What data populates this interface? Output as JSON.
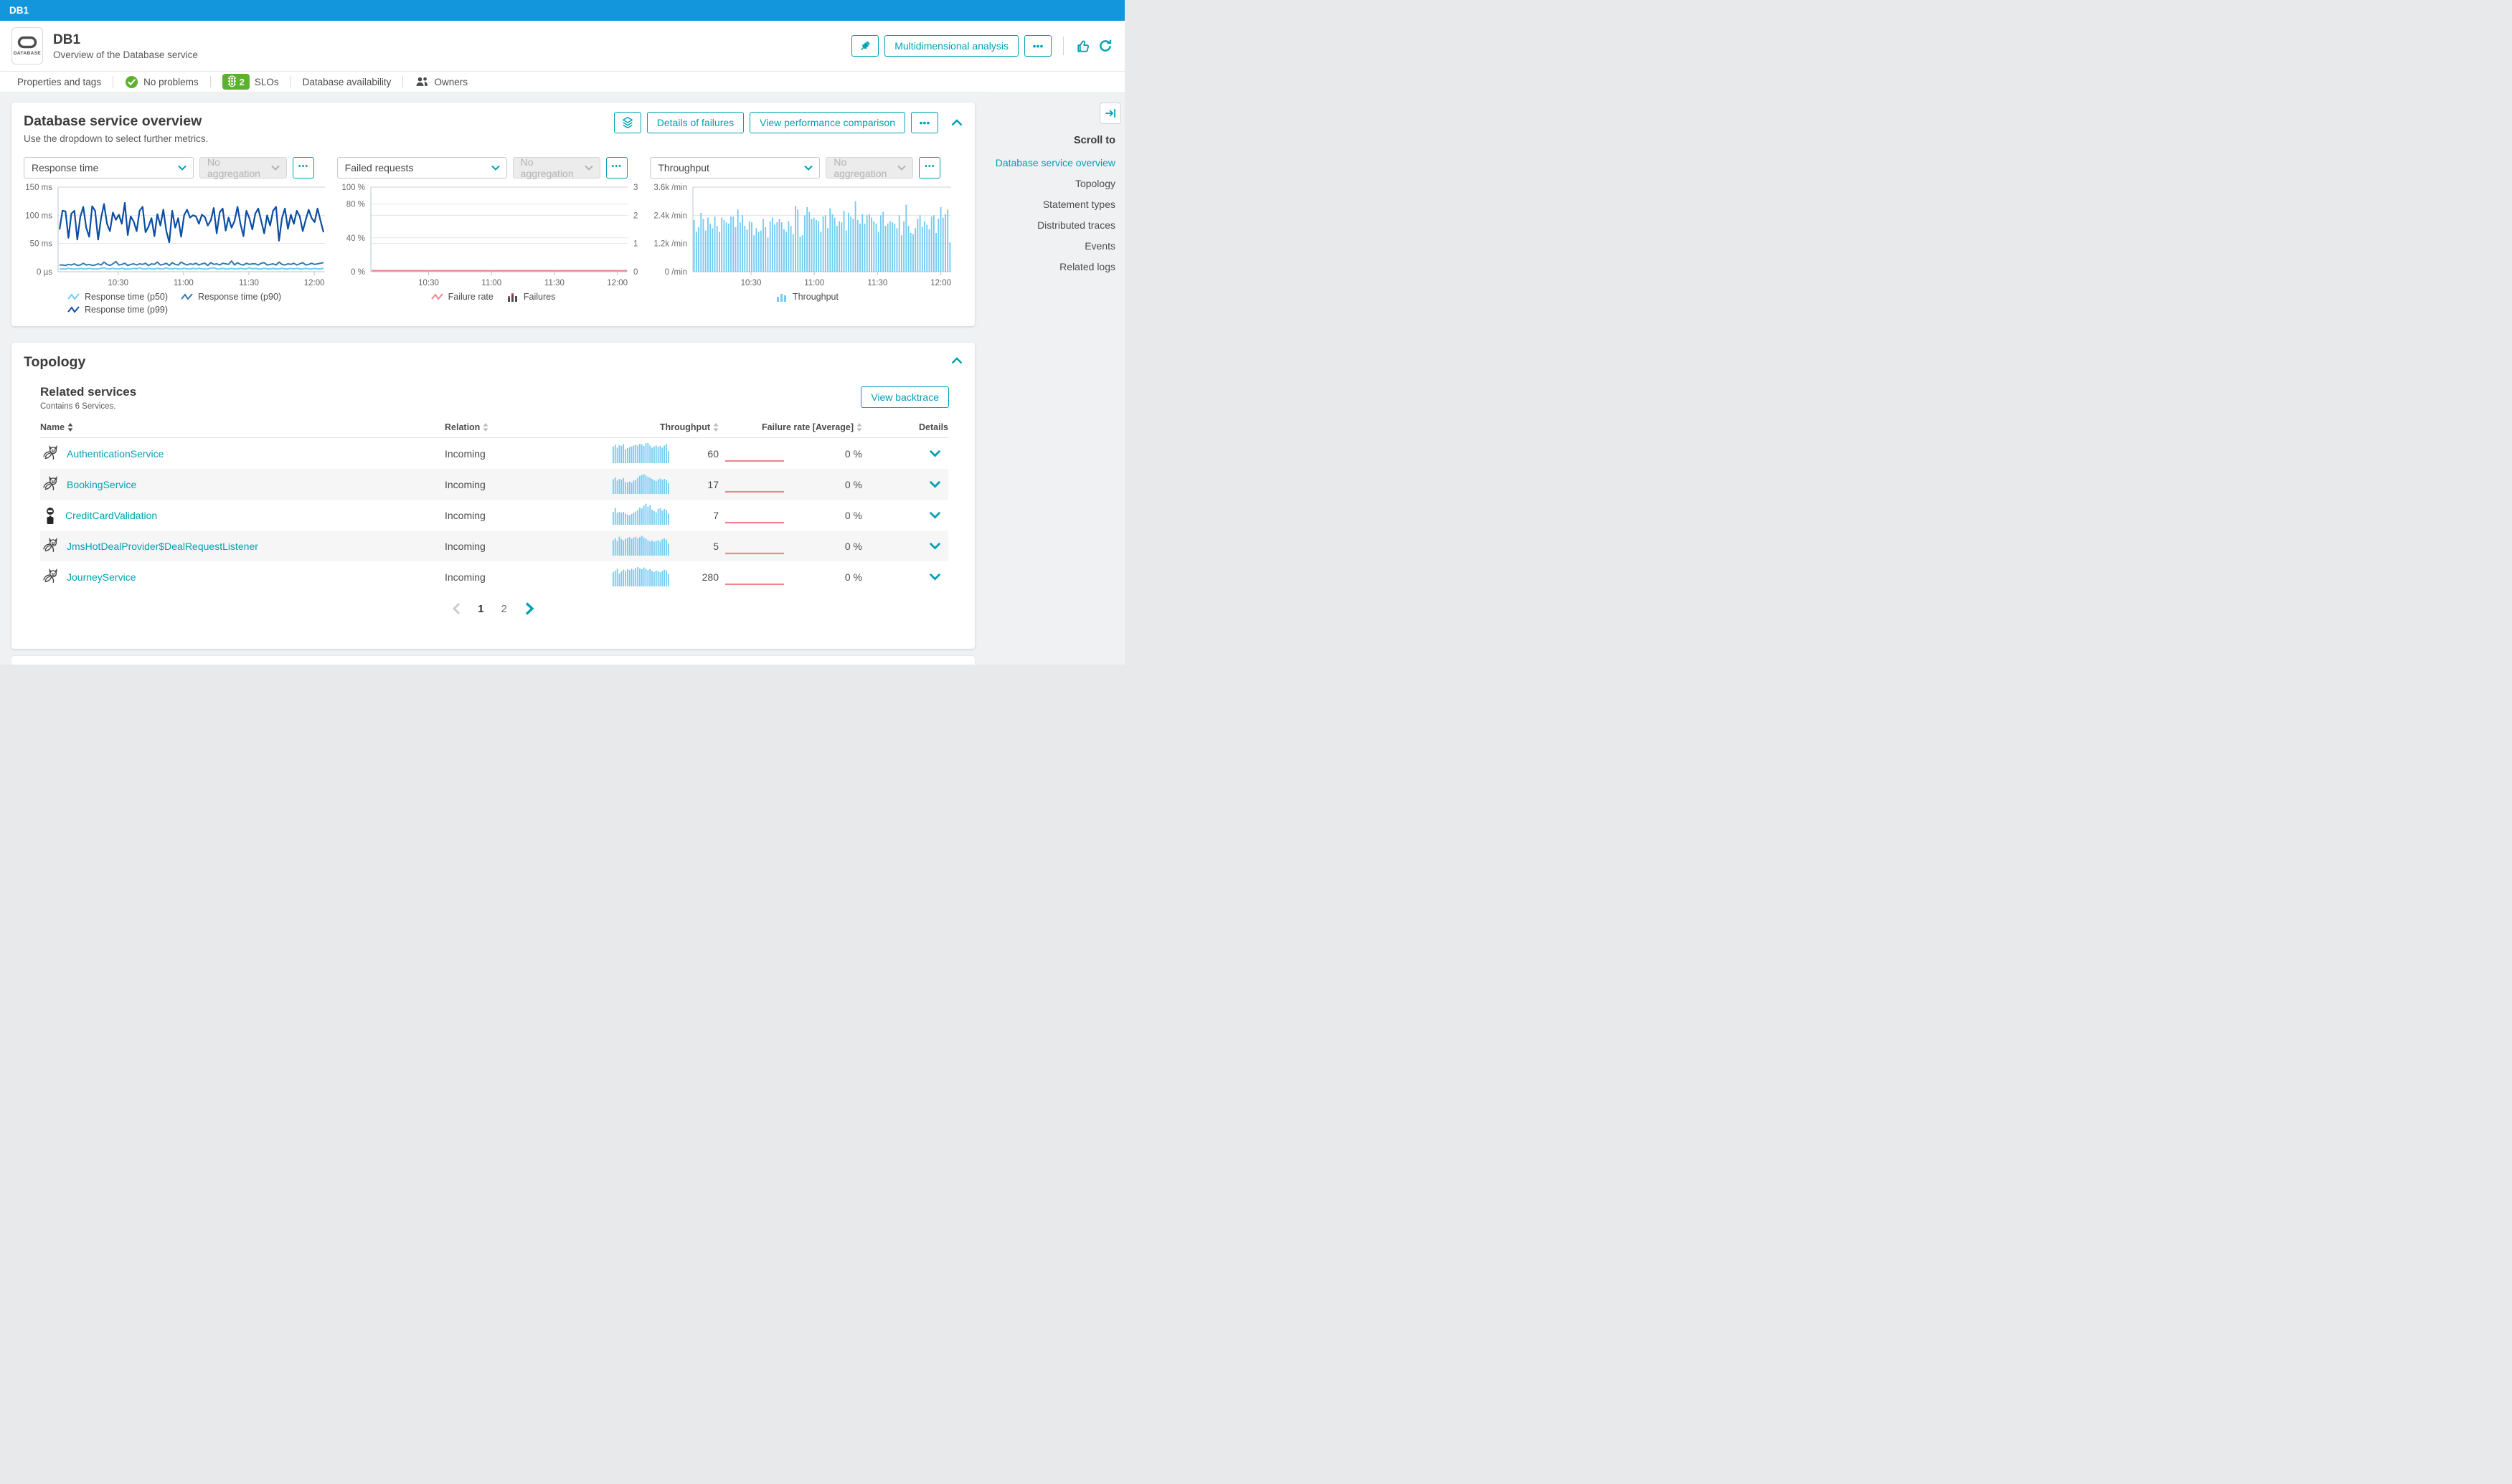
{
  "topbar": {
    "breadcrumb": "DB1"
  },
  "header": {
    "title": "DB1",
    "subtitle": "Overview of the Database service",
    "entity_icon_label": "DATABASE",
    "actions": {
      "multidimensional": "Multidimensional analysis",
      "more": "•••"
    }
  },
  "tabs": {
    "items": [
      {
        "label": "Properties and tags"
      },
      {
        "label": "No problems"
      },
      {
        "label": "SLOs",
        "badge": "2"
      },
      {
        "label": "Database availability"
      },
      {
        "label": "Owners"
      }
    ]
  },
  "side_panel": {
    "scroll_to_title": "Scroll to",
    "links": [
      {
        "label": "Database service overview",
        "active": true
      },
      {
        "label": "Topology",
        "active": false
      },
      {
        "label": "Statement types",
        "active": false
      },
      {
        "label": "Distributed traces",
        "active": false
      },
      {
        "label": "Events",
        "active": false
      },
      {
        "label": "Related logs",
        "active": false
      }
    ]
  },
  "overview_card": {
    "title": "Database service overview",
    "subtitle": "Use the dropdown to select further metrics.",
    "buttons": {
      "details_of_failures": "Details of failures",
      "view_performance_comparison": "View performance comparison",
      "more": "•••"
    },
    "selectors": [
      {
        "metric": "Response time",
        "aggregation": "No aggregation",
        "more": "•••"
      },
      {
        "metric": "Failed requests",
        "aggregation": "No aggregation",
        "more": "•••"
      },
      {
        "metric": "Throughput",
        "aggregation": "No aggregation",
        "more": "•••"
      }
    ]
  },
  "chart_data": [
    {
      "type": "line",
      "title": "Response time",
      "ylim": [
        0,
        150
      ],
      "yticks": [
        {
          "f": 0,
          "label": "150 ms"
        },
        {
          "f": 0.3333,
          "label": "100 ms"
        },
        {
          "f": 0.6667,
          "label": "50 ms"
        },
        {
          "f": 1,
          "label": "0 µs"
        }
      ],
      "xticks": [
        {
          "f": 0.225,
          "label": "10:30"
        },
        {
          "f": 0.47,
          "label": "11:00"
        },
        {
          "f": 0.715,
          "label": "11:30"
        },
        {
          "f": 0.96,
          "label": "12:00"
        }
      ],
      "series": [
        {
          "name": "Response time (p99)",
          "color": "#0b4ea2",
          "width": 2.2,
          "values": [
            75,
            108,
            107,
            60,
            103,
            108,
            57,
            97,
            115,
            78,
            62,
            116,
            108,
            57,
            95,
            120,
            85,
            72,
            105,
            92,
            101,
            85,
            122,
            65,
            98,
            89,
            72,
            108,
            115,
            70,
            80,
            95,
            63,
            102,
            82,
            110,
            72,
            52,
            108,
            78,
            95,
            62,
            100,
            110,
            96,
            100,
            98,
            85,
            101,
            97,
            82,
            91,
            113,
            68,
            105,
            112,
            73,
            96,
            78,
            90,
            115,
            85,
            63,
            108,
            95,
            75,
            103,
            112,
            90,
            68,
            100,
            82,
            108,
            115,
            55,
            95,
            112,
            76,
            101,
            85,
            108,
            98,
            72,
            92,
            110,
            95,
            88,
            112,
            90,
            70
          ]
        },
        {
          "name": "Response time (p90)",
          "color": "#3878ad",
          "width": 2,
          "values": [
            12,
            12,
            11,
            13,
            12,
            14,
            11,
            12,
            15,
            12,
            13,
            11,
            12,
            14,
            12,
            17,
            13,
            11,
            14,
            18,
            12,
            13,
            15,
            11,
            13,
            14,
            12,
            14,
            13,
            15,
            11,
            14,
            13,
            17,
            12,
            13,
            15,
            11,
            16,
            13,
            12,
            17,
            14,
            12,
            14,
            13,
            15,
            12,
            14,
            15,
            11,
            16,
            13,
            14,
            12,
            15,
            14,
            13,
            19,
            12,
            16,
            13,
            12,
            15,
            13,
            14,
            14,
            12,
            15,
            16,
            12,
            13,
            14,
            12,
            17,
            13,
            12,
            14,
            13,
            15,
            12,
            14,
            16,
            12,
            13,
            15,
            13,
            14,
            15,
            16
          ]
        },
        {
          "name": "Response time (p50)",
          "color": "#74cbf2",
          "width": 2,
          "values": [
            5,
            5,
            5,
            6,
            5,
            5,
            5,
            6,
            5,
            5,
            6,
            5,
            5,
            5,
            6,
            7,
            5,
            5,
            6,
            5,
            5,
            6,
            5,
            5,
            5,
            6,
            5,
            7,
            5,
            5,
            6,
            5,
            5,
            6,
            5,
            5,
            7,
            5,
            5,
            6,
            5,
            5,
            6,
            5,
            5,
            6,
            5,
            6,
            5,
            5,
            5,
            6,
            7,
            5,
            5,
            6,
            5,
            5,
            6,
            5,
            5,
            6,
            5,
            5,
            7,
            5,
            6,
            5,
            5,
            6,
            5,
            5,
            6,
            5,
            5,
            6,
            5,
            5,
            6,
            5,
            6,
            5,
            5,
            6,
            5,
            5,
            6,
            5,
            5,
            6
          ]
        }
      ],
      "legend": [
        {
          "label": "Response time (p50)",
          "swatch": "line",
          "color": "#74cbf2"
        },
        {
          "label": "Response time (p90)",
          "swatch": "line",
          "color": "#3878ad"
        },
        {
          "label": "Response time (p99)",
          "swatch": "line",
          "color": "#0b4ea2"
        }
      ]
    },
    {
      "type": "line",
      "title": "Failed requests",
      "ylim": [
        0,
        100
      ],
      "yticks": [
        {
          "f": 0,
          "label": "100 %"
        },
        {
          "f": 0.2,
          "label": "80 %"
        },
        {
          "f": 0.6,
          "label": "40 %"
        },
        {
          "f": 1,
          "label": "0 %"
        }
      ],
      "grid_extra": [
        0.3333,
        0.6667
      ],
      "yticks_right": [
        {
          "f": 0,
          "label": "3"
        },
        {
          "f": 0.3333,
          "label": "2"
        },
        {
          "f": 0.6667,
          "label": "1"
        },
        {
          "f": 1,
          "label": "0"
        }
      ],
      "xticks": [
        {
          "f": 0.225,
          "label": "10:30"
        },
        {
          "f": 0.47,
          "label": "11:00"
        },
        {
          "f": 0.715,
          "label": "11:30"
        },
        {
          "f": 0.96,
          "label": "12:00"
        }
      ],
      "series": [
        {
          "name": "Failure rate",
          "color": "#ef8591",
          "width": 2,
          "flat": true,
          "values": [
            0,
            0
          ]
        },
        {
          "name": "Failures",
          "color": "#4d4d4d",
          "values": []
        }
      ],
      "legend": [
        {
          "label": "Failure rate",
          "swatch": "line",
          "color": "#ef8591"
        },
        {
          "label": "Failures",
          "swatch": "failbars",
          "color": "#4d4d4d"
        }
      ]
    },
    {
      "type": "bar",
      "title": "Throughput",
      "ylim": [
        0,
        3600
      ],
      "bar_color": "#74cbf2",
      "yticks": [
        {
          "f": 0,
          "label": "3.6k /min"
        },
        {
          "f": 0.3333,
          "label": "2.4k /min"
        },
        {
          "f": 0.6667,
          "label": "1.2k /min"
        },
        {
          "f": 1,
          "label": "0 /min"
        }
      ],
      "xticks": [
        {
          "f": 0.225,
          "label": "10:30"
        },
        {
          "f": 0.47,
          "label": "11:00"
        },
        {
          "f": 0.715,
          "label": "11:30"
        },
        {
          "f": 0.96,
          "label": "12:00"
        }
      ],
      "values": [
        2200,
        1700,
        1900,
        2500,
        2250,
        1750,
        2300,
        2050,
        1850,
        2350,
        1950,
        1700,
        2300,
        2200,
        2100,
        2050,
        2350,
        2350,
        1900,
        2650,
        2100,
        2400,
        1950,
        1800,
        2150,
        2100,
        1550,
        1850,
        1700,
        1750,
        2250,
        1900,
        1450,
        2150,
        2300,
        2000,
        2100,
        2250,
        2100,
        1800,
        1700,
        2150,
        1950,
        1600,
        2800,
        2650,
        1500,
        1550,
        2400,
        2750,
        2550,
        2250,
        2300,
        2200,
        2150,
        1700,
        2350,
        2400,
        1850,
        2700,
        2450,
        2300,
        1950,
        2150,
        2100,
        2600,
        1750,
        2500,
        2350,
        2250,
        3000,
        2200,
        2050,
        2450,
        2050,
        2400,
        2450,
        2300,
        2150,
        2050,
        1700,
        2400,
        2550,
        1950,
        2050,
        2150,
        2100,
        2050,
        1850,
        2400,
        1550,
        2150,
        2850,
        1950,
        1650,
        1600,
        1850,
        2250,
        2400,
        1900,
        2150,
        2000,
        1800,
        2350,
        2400,
        1650,
        2250,
        2750,
        2300,
        2450,
        2650,
        1250
      ],
      "legend": [
        {
          "label": "Throughput",
          "swatch": "bars",
          "color": "#74cbf2"
        }
      ]
    }
  ],
  "topology_card": {
    "title": "Topology",
    "section_title": "Related services",
    "section_subtitle": "Contains 6 Services.",
    "backtrace_button": "View backtrace",
    "table": {
      "columns": [
        "Name",
        "Relation",
        "Throughput",
        "Failure rate [Average]",
        "Details"
      ],
      "rows": [
        {
          "name": "AuthenticationService",
          "icon": "tomcat",
          "relation": "Incoming",
          "throughput": "60",
          "failure_rate": "0 %",
          "spark": [
            0.78,
            0.86,
            0.72,
            0.84,
            0.8,
            0.88,
            0.64,
            0.7,
            0.74,
            0.78,
            0.82,
            0.86,
            0.82,
            0.9,
            0.86,
            0.8,
            0.92,
            0.94,
            0.82,
            0.72,
            0.78,
            0.82,
            0.76,
            0.8,
            0.72,
            0.82,
            0.88,
            0.56
          ]
        },
        {
          "name": "BookingService",
          "icon": "tomcat",
          "relation": "Incoming",
          "throughput": "17",
          "failure_rate": "0 %",
          "spark": [
            0.68,
            0.76,
            0.62,
            0.7,
            0.66,
            0.74,
            0.56,
            0.54,
            0.58,
            0.52,
            0.62,
            0.66,
            0.74,
            0.84,
            0.88,
            0.92,
            0.86,
            0.8,
            0.76,
            0.7,
            0.64,
            0.6,
            0.68,
            0.72,
            0.66,
            0.7,
            0.64,
            0.5
          ]
        },
        {
          "name": "CreditCardValidation",
          "icon": "person",
          "relation": "Incoming",
          "throughput": "7",
          "failure_rate": "0 %",
          "spark": [
            0.6,
            0.78,
            0.56,
            0.6,
            0.56,
            0.6,
            0.52,
            0.48,
            0.44,
            0.5,
            0.56,
            0.62,
            0.68,
            0.8,
            0.76,
            0.88,
            0.98,
            0.84,
            0.92,
            0.7,
            0.64,
            0.58,
            0.74,
            0.78,
            0.66,
            0.74,
            0.7,
            0.52
          ]
        },
        {
          "name": "JmsHotDealProvider$DealRequestListener",
          "icon": "tomcat",
          "relation": "Incoming",
          "throughput": "5",
          "failure_rate": "0 %",
          "spark": [
            0.72,
            0.8,
            0.68,
            0.88,
            0.76,
            0.7,
            0.78,
            0.82,
            0.86,
            0.78,
            0.84,
            0.88,
            0.8,
            0.86,
            0.92,
            0.84,
            0.78,
            0.72,
            0.66,
            0.7,
            0.64,
            0.68,
            0.72,
            0.66,
            0.76,
            0.8,
            0.74,
            0.56
          ]
        },
        {
          "name": "JourneyService",
          "icon": "tomcat",
          "relation": "Incoming",
          "throughput": "280",
          "failure_rate": "0 %",
          "spark": [
            0.66,
            0.74,
            0.82,
            0.6,
            0.7,
            0.78,
            0.72,
            0.8,
            0.76,
            0.82,
            0.78,
            0.86,
            0.9,
            0.84,
            0.8,
            0.88,
            0.82,
            0.76,
            0.8,
            0.72,
            0.68,
            0.74,
            0.7,
            0.66,
            0.72,
            0.78,
            0.74,
            0.58
          ]
        }
      ]
    },
    "pagination": {
      "pages": [
        {
          "label": "1",
          "current": true
        },
        {
          "label": "2",
          "current": false
        }
      ]
    }
  },
  "colors": {
    "topbar_blue": "#1496dc",
    "accent_teal": "#00a1b2",
    "green": "#5cb22e",
    "failure_red": "#ef8591",
    "series_p50": "#74cbf2",
    "series_p90": "#3878ad",
    "series_p99": "#0b4ea2",
    "bars_blue": "#74cbf2"
  }
}
